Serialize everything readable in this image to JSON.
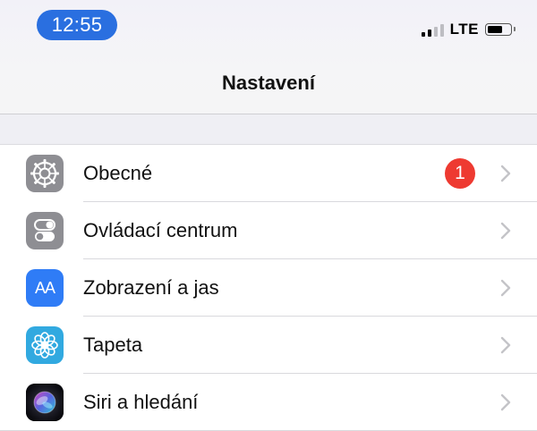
{
  "status_bar": {
    "time": "12:55",
    "network": "LTE",
    "signal_bars_active": 2,
    "signal_bars_total": 4
  },
  "header": {
    "title": "Nastavení"
  },
  "settings": {
    "items": [
      {
        "label": "Obecné",
        "icon": "gear-icon",
        "badge": "1"
      },
      {
        "label": "Ovládací centrum",
        "icon": "toggle-switches-icon"
      },
      {
        "label": "Zobrazení a jas",
        "icon": "text-size-icon",
        "icon_text": "AA"
      },
      {
        "label": "Tapeta",
        "icon": "flower-icon"
      },
      {
        "label": "Siri a hledání",
        "icon": "siri-icon"
      }
    ]
  },
  "colors": {
    "time_pill": "#2a6fe0",
    "badge": "#ee3a31",
    "display_icon": "#2f7cf6",
    "wallpaper_icon": "#31a9e0",
    "gray_icon": "#8e8e93"
  }
}
